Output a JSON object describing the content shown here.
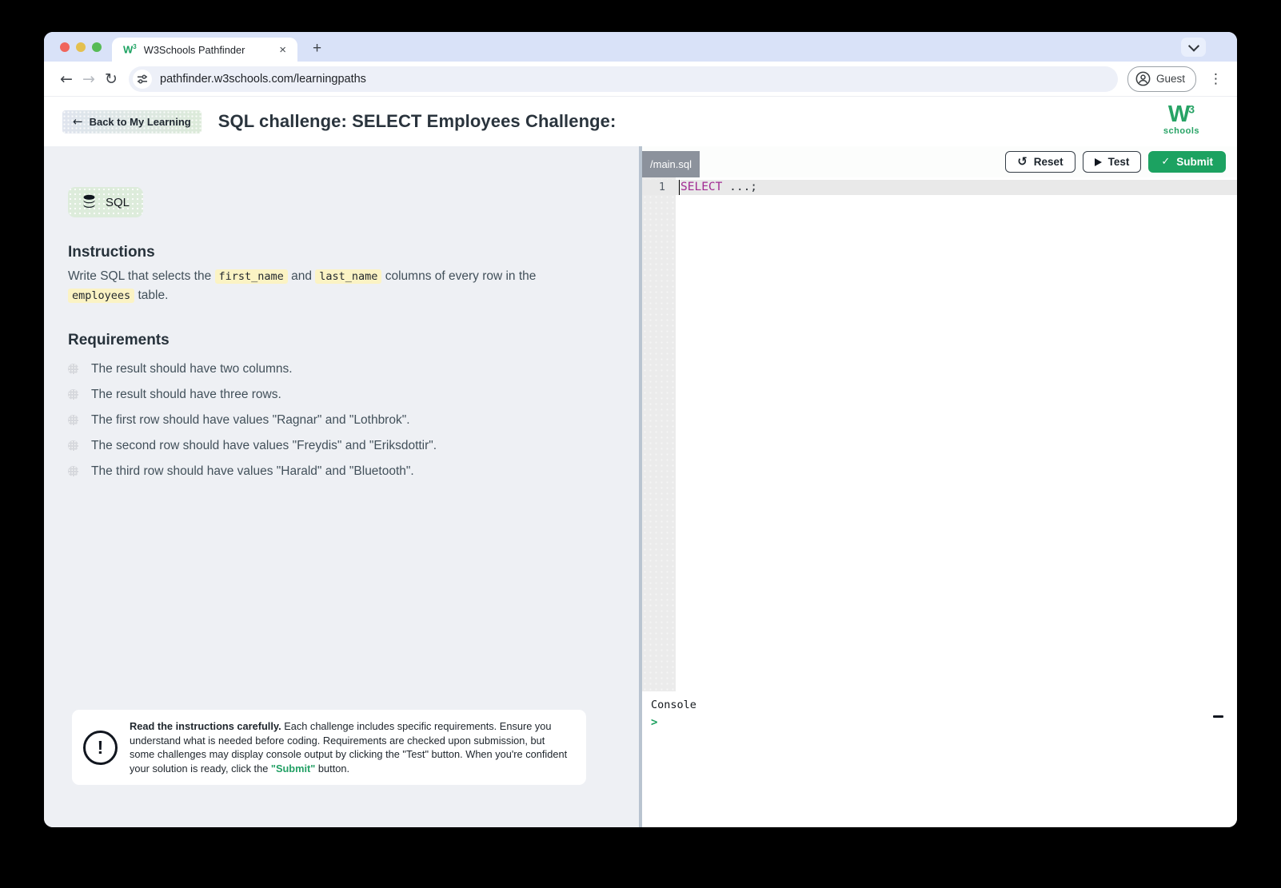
{
  "browser": {
    "tab_title": "W3Schools Pathfinder",
    "url": "pathfinder.w3schools.com/learningpaths",
    "profile_label": "Guest"
  },
  "logo": {
    "mark": "W",
    "sup": "3",
    "word": "schools"
  },
  "header": {
    "back_button": "Back to My Learning",
    "title": "SQL challenge: SELECT Employees Challenge:"
  },
  "panel": {
    "language_badge": "SQL",
    "instructions": {
      "heading": "Instructions",
      "segments": [
        {
          "t": "Write SQL that selects the "
        },
        {
          "c": "first_name"
        },
        {
          "t": " and "
        },
        {
          "c": "last_name"
        },
        {
          "t": " columns of every row in the "
        },
        {
          "c": "employees"
        },
        {
          "t": " table."
        }
      ]
    },
    "requirements": {
      "heading": "Requirements",
      "items": [
        "The result should have two columns.",
        "The result should have three rows.",
        "The first row should have values \"Ragnar\" and \"Lothbrok\".",
        "The second row should have values \"Freydis\" and \"Eriksdottir\".",
        "The third row should have values \"Harald\" and \"Bluetooth\"."
      ]
    },
    "note": {
      "segments": [
        {
          "b": "Read the instructions carefully."
        },
        {
          "t": " Each challenge includes specific requirements. Ensure you understand what is needed before coding. Requirements are checked upon submission, but some challenges may display console output by clicking the \"Test\" button. When you're confident your solution is ready, click the "
        },
        {
          "g": "\"Submit\""
        },
        {
          "t": " button."
        }
      ]
    }
  },
  "editor": {
    "file_tab": "/main.sql",
    "buttons": {
      "reset": "Reset",
      "test": "Test",
      "submit": "Submit"
    },
    "line": {
      "number": "1",
      "tokens": [
        {
          "kw": "SELECT"
        },
        {
          "t": " ...;"
        }
      ]
    },
    "console": {
      "label": "Console",
      "prompt": ">"
    }
  },
  "icons": {
    "back": "←",
    "forward": "→",
    "reload": "↻",
    "close": "×",
    "new_tab": "+",
    "kebab": "⋮",
    "undo": "↺",
    "check": "✓",
    "exclaim": "!"
  },
  "colors": {
    "brand_green": "#1ca261",
    "keyword_purple": "#a12a93",
    "code_highlight_yellow": "#fbf3c4",
    "tabstrip_blue": "#d9e2f8"
  }
}
